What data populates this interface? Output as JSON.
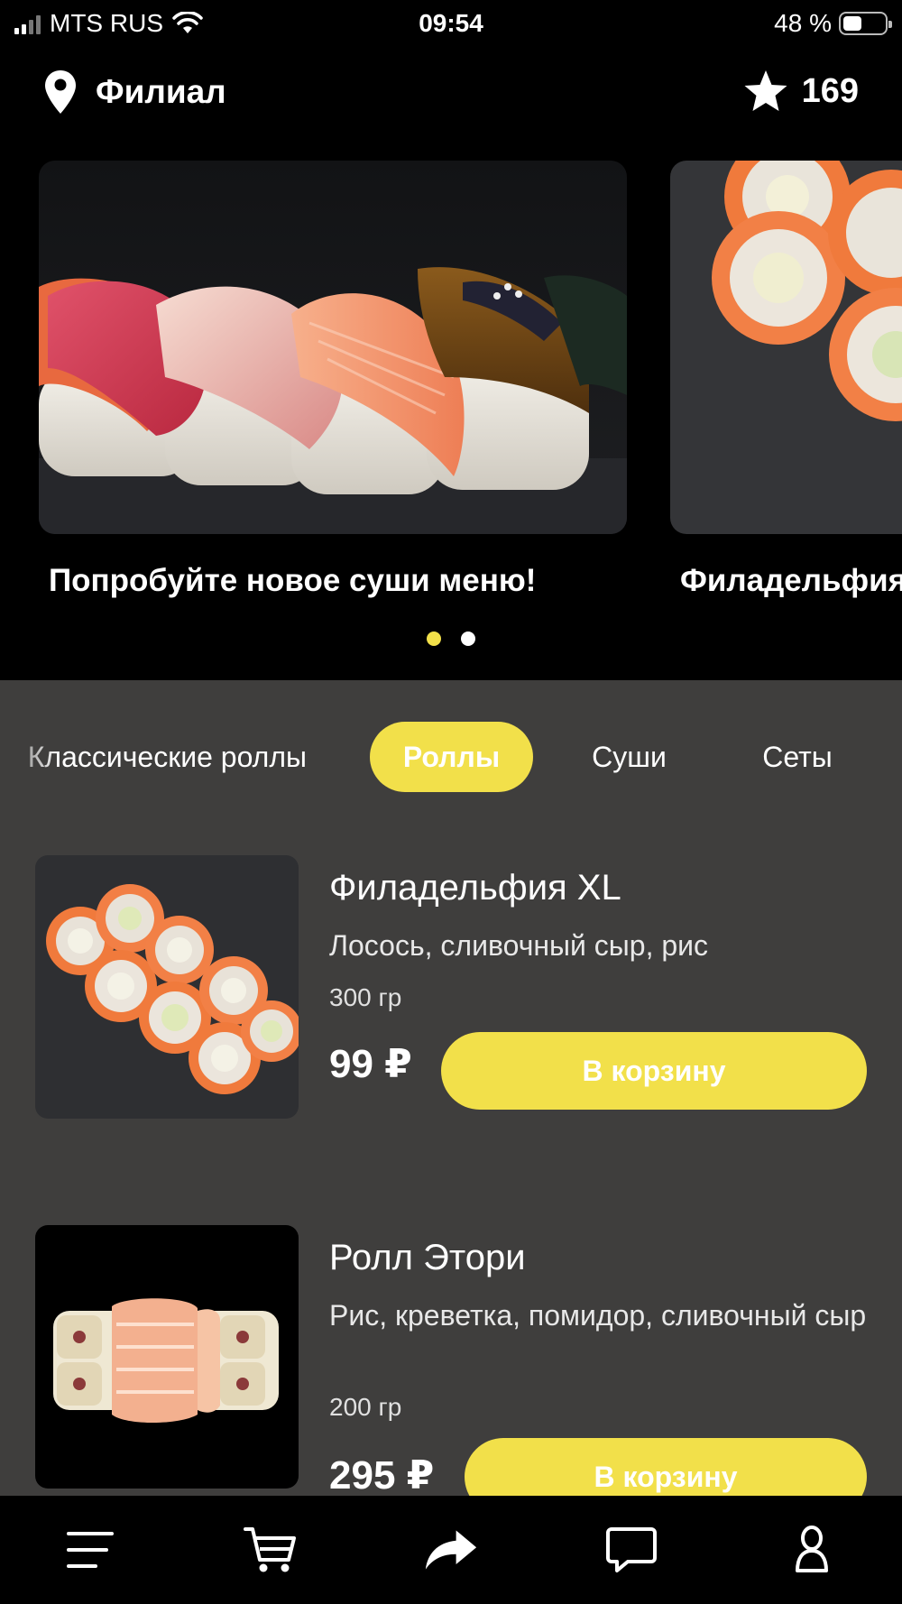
{
  "status_bar": {
    "carrier": "MTS RUS",
    "time": "09:54",
    "battery": "48 %",
    "battery_level": 0.48
  },
  "header": {
    "branch_label": "Филиал",
    "bonus_points": "169"
  },
  "banners": [
    {
      "caption": "Попробуйте новое суши меню!"
    },
    {
      "caption": "Филадельфия"
    }
  ],
  "pagination": {
    "count": 2,
    "active": 0
  },
  "categories": [
    {
      "label": "Классические роллы",
      "active": false
    },
    {
      "label": "Роллы",
      "active": true
    },
    {
      "label": "Суши",
      "active": false
    },
    {
      "label": "Сеты",
      "active": false
    }
  ],
  "products": [
    {
      "name": "Филадельфия XL",
      "description": "Лосось, сливочный сыр, рис",
      "weight": "300 гр",
      "price": "99 ₽",
      "button": "В корзину"
    },
    {
      "name": "Ролл Этори",
      "description": "Рис, креветка, помидор, сливочный сыр",
      "weight": "200 гр",
      "price": "295 ₽",
      "button": "В корзину"
    }
  ],
  "bottom_nav": [
    {
      "icon": "menu-icon"
    },
    {
      "icon": "cart-icon"
    },
    {
      "icon": "share-icon"
    },
    {
      "icon": "chat-icon"
    },
    {
      "icon": "profile-icon"
    }
  ],
  "colors": {
    "accent": "#f2e04a",
    "background": "#3f3e3d",
    "header_bg": "#000000"
  }
}
